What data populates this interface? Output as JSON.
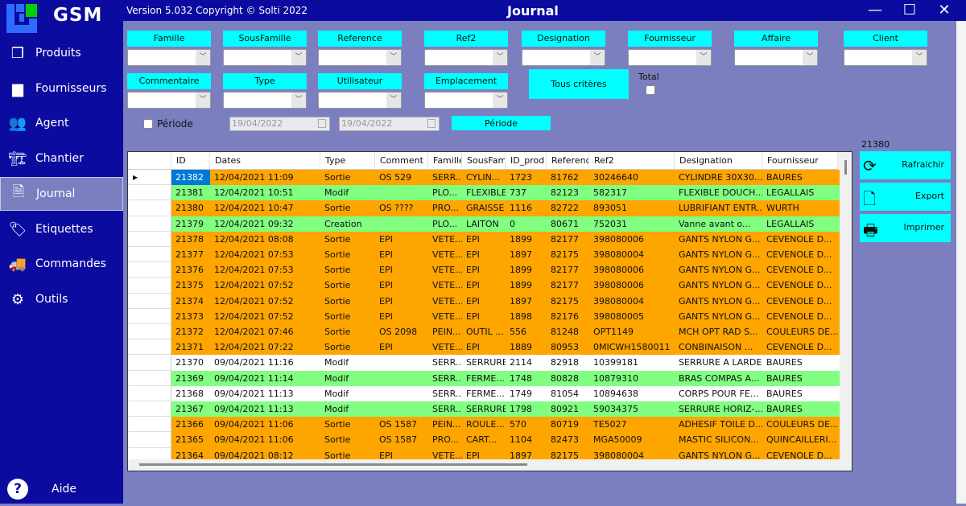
{
  "app": {
    "logo_text": "GSM",
    "version": "Version 5.032  Copyright © Solti 2022",
    "window_title": "Journal",
    "accent": "#00ffff",
    "sidebar_bg": "#0b0ba0",
    "content_bg": "#7b7fc0"
  },
  "sidebar": {
    "items": [
      {
        "label": "Produits",
        "icon": "cubes-icon",
        "glyph": "❒"
      },
      {
        "label": "Fournisseurs",
        "icon": "box-open-icon",
        "glyph": "▆"
      },
      {
        "label": "Agent",
        "icon": "users-icon",
        "glyph": "👥"
      },
      {
        "label": "Chantier",
        "icon": "building-icon",
        "glyph": "🏗"
      },
      {
        "label": "Journal",
        "icon": "file-icon",
        "glyph": "🗎"
      },
      {
        "label": "Etiquettes",
        "icon": "tags-icon",
        "glyph": "🏷"
      },
      {
        "label": "Commandes",
        "icon": "truck-icon",
        "glyph": "🚚"
      },
      {
        "label": "Outils",
        "icon": "gear-icon",
        "glyph": "⚙"
      }
    ],
    "selected": "Journal",
    "help": {
      "label": "Aide",
      "icon": "question-circle-icon",
      "glyph": "?"
    }
  },
  "filters": {
    "row1": [
      "Famille",
      "SousFamille",
      "Reference",
      "Ref2",
      "Designation",
      "Fournisseur",
      "Affaire",
      "Client"
    ],
    "row2": [
      "Commentaire",
      "Type",
      "Utilisateur",
      "Emplacement"
    ],
    "all_criteria_label": "Tous critères",
    "total_label": "Total",
    "total_checked": false,
    "periode_label": "Période",
    "periode_checked": false,
    "date_from": "19/04/2022",
    "date_to": "19/04/2022",
    "periode_button": "Période"
  },
  "actions": {
    "count": "21380",
    "refresh": "Rafraichir",
    "export": "Export",
    "print": "Imprimer"
  },
  "grid": {
    "colors": {
      "Sortie": "#ffa500",
      "green": "#80ff80",
      "white": "#ffffff",
      "selected": "#0078d7"
    },
    "columns": [
      "ID",
      "Dates",
      "Type",
      "Comment",
      "Famille",
      "SousFam",
      "ID_prod",
      "Referenc",
      "Ref2",
      "Designation",
      "Fournisseur"
    ],
    "rows": [
      {
        "c": "orange",
        "v": [
          "21382",
          "12/04/2021 11:09",
          "Sortie",
          "OS 529",
          "SERR...",
          "CYLIN...",
          "1723",
          "81762",
          "30246640",
          "CYLINDRE 30X30...",
          "BAURES"
        ]
      },
      {
        "c": "green",
        "v": [
          "21381",
          "12/04/2021 10:51",
          "Modif",
          "",
          "PLO...",
          "FLEXIBLE",
          "737",
          "82123",
          "582317",
          "FLEXIBLE DOUCH...",
          "LEGALLAIS"
        ]
      },
      {
        "c": "orange",
        "v": [
          "21380",
          "12/04/2021 10:47",
          "Sortie",
          "OS ????",
          "PRO...",
          "GRAISSE",
          "1116",
          "82722",
          "893051",
          "LUBRIFIANT ENTR...",
          "WURTH"
        ]
      },
      {
        "c": "green",
        "v": [
          "21379",
          "12/04/2021 09:32",
          "Creation",
          "",
          "PLO...",
          "LAITON",
          "0",
          "80671",
          "752031",
          "Vanne avant o...",
          "LEGALLAIS"
        ]
      },
      {
        "c": "orange",
        "v": [
          "21378",
          "12/04/2021 08:08",
          "Sortie",
          "EPI",
          "VETE...",
          "EPI",
          "1899",
          "82177",
          "398080006",
          "GANTS NYLON G...",
          "CEVENOLE D..."
        ]
      },
      {
        "c": "orange",
        "v": [
          "21377",
          "12/04/2021 07:53",
          "Sortie",
          "EPI",
          "VETE...",
          "EPI",
          "1897",
          "82175",
          "398080004",
          "GANTS NYLON G...",
          "CEVENOLE D..."
        ]
      },
      {
        "c": "orange",
        "v": [
          "21376",
          "12/04/2021 07:53",
          "Sortie",
          "EPI",
          "VETE...",
          "EPI",
          "1899",
          "82177",
          "398080006",
          "GANTS NYLON G...",
          "CEVENOLE D..."
        ]
      },
      {
        "c": "orange",
        "v": [
          "21375",
          "12/04/2021 07:52",
          "Sortie",
          "EPI",
          "VETE...",
          "EPI",
          "1899",
          "82177",
          "398080006",
          "GANTS NYLON G...",
          "CEVENOLE D..."
        ]
      },
      {
        "c": "orange",
        "v": [
          "21374",
          "12/04/2021 07:52",
          "Sortie",
          "EPI",
          "VETE...",
          "EPI",
          "1897",
          "82175",
          "398080004",
          "GANTS NYLON G...",
          "CEVENOLE D..."
        ]
      },
      {
        "c": "orange",
        "v": [
          "21373",
          "12/04/2021 07:52",
          "Sortie",
          "EPI",
          "VETE...",
          "EPI",
          "1898",
          "82176",
          "398080005",
          "GANTS NYLON G...",
          "CEVENOLE D..."
        ]
      },
      {
        "c": "orange",
        "v": [
          "21372",
          "12/04/2021 07:46",
          "Sortie",
          "OS 2098",
          "PEIN...",
          "OUTIL ...",
          "556",
          "81248",
          "OPT1149",
          "MCH OPT RAD S...",
          "COULEURS DE..."
        ]
      },
      {
        "c": "orange",
        "v": [
          "21371",
          "12/04/2021 07:22",
          "Sortie",
          "EPI",
          "VETE...",
          "EPI",
          "1889",
          "80953",
          "0MICWH1580011",
          "CONBINAISON ...",
          "CEVENOLE D..."
        ]
      },
      {
        "c": "white",
        "v": [
          "21370",
          "09/04/2021 11:16",
          "Modif",
          "",
          "SERR...",
          "SERRURE",
          "2114",
          "82918",
          "10399181",
          "SERRURE A LARDER",
          "BAURES"
        ]
      },
      {
        "c": "green",
        "v": [
          "21369",
          "09/04/2021 11:14",
          "Modif",
          "",
          "SERR...",
          "FERME...",
          "1748",
          "80828",
          "10879310",
          "BRAS COMPAS A...",
          "BAURES"
        ]
      },
      {
        "c": "white",
        "v": [
          "21368",
          "09/04/2021 11:13",
          "Modif",
          "",
          "SERR...",
          "FERME...",
          "1749",
          "81054",
          "10894638",
          "CORPS POUR FE...",
          "BAURES"
        ]
      },
      {
        "c": "green",
        "v": [
          "21367",
          "09/04/2021 11:13",
          "Modif",
          "",
          "SERR...",
          "SERRURE",
          "1798",
          "80921",
          "59034375",
          "SERRURE HORIZ-...",
          "BAURES"
        ]
      },
      {
        "c": "orange",
        "v": [
          "21366",
          "09/04/2021 11:06",
          "Sortie",
          "OS 1587",
          "PEIN...",
          "ROULE...",
          "570",
          "80719",
          "TE5027",
          "ADHESIF TOILE D...",
          "COULEURS DE..."
        ]
      },
      {
        "c": "orange",
        "v": [
          "21365",
          "09/04/2021 11:06",
          "Sortie",
          "OS 1587",
          "PRO...",
          "CART...",
          "1104",
          "82473",
          "MGA50009",
          "MASTIC SILICON...",
          "QUINCAILLERI..."
        ]
      },
      {
        "c": "orange",
        "v": [
          "21364",
          "09/04/2021 08:12",
          "Sortie",
          "EPI",
          "VETE...",
          "EPI",
          "1897",
          "82175",
          "398080004",
          "GANTS NYLON G...",
          "CEVENOLE D..."
        ]
      }
    ],
    "selected_row": 0
  }
}
